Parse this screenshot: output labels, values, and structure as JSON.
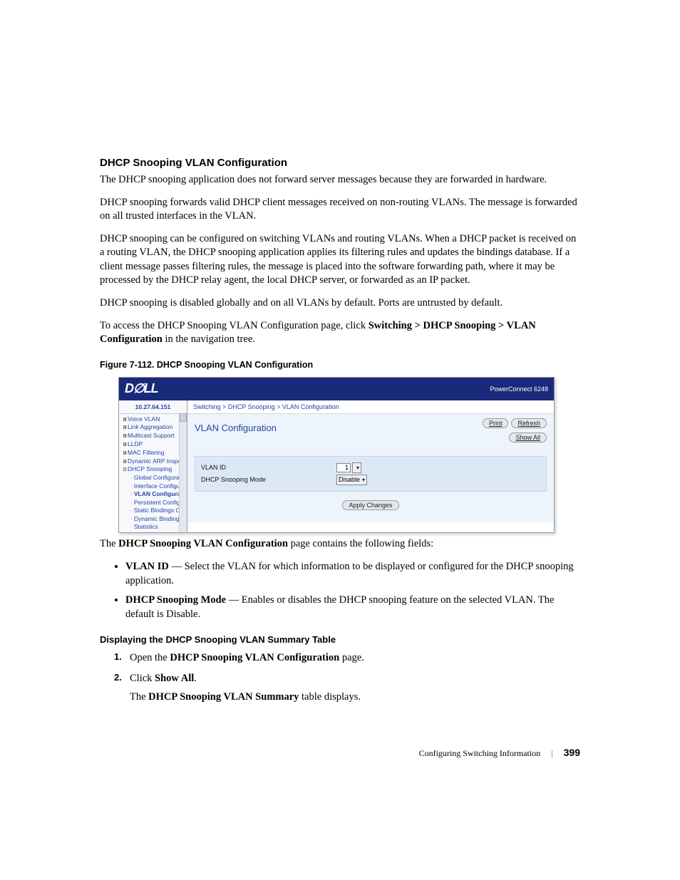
{
  "heading": "DHCP Snooping VLAN Configuration",
  "para1": "The DHCP snooping application does not forward server messages because they are forwarded in hardware.",
  "para2": "DHCP snooping forwards valid DHCP client messages received on non-routing VLANs. The message is forwarded on all trusted interfaces in the VLAN.",
  "para3": "DHCP snooping can be configured on switching VLANs and routing VLANs. When a DHCP packet is received on a routing VLAN, the DHCP snooping application applies its filtering rules and updates the bindings database. If a client message passes filtering rules, the message is placed into the software forwarding path, where it may be processed by the DHCP relay agent, the local DHCP server, or forwarded as an IP packet.",
  "para4": "DHCP snooping is disabled globally and on all VLANs by default. Ports are untrusted by default.",
  "para5_a": "To access the DHCP Snooping VLAN Configuration page, click ",
  "para5_b": "Switching > DHCP Snooping > VLAN Configuration",
  "para5_c": " in the navigation tree.",
  "figcap": "Figure 7-112.    DHCP Snooping VLAN Configuration",
  "shot": {
    "logo": "D∅LL",
    "product": "PowerConnect 6248",
    "ip": "10.27.64.151",
    "nav": {
      "items": [
        "Voice VLAN",
        "Link Aggregation",
        "Multicast Support",
        "LLDP",
        "MAC Filtering",
        "Dynamic ARP Inspe"
      ],
      "dhcp_label": "DHCP Snooping",
      "sub": [
        "Global Configurat",
        "Interface Configu",
        "VLAN Configurati",
        "Persistent Config",
        "Static Bindings C",
        "Dynamic Binding",
        "Statistics"
      ]
    },
    "breadcrumb": "Switching > DHCP Snooping > VLAN Configuration",
    "title": "VLAN Configuration",
    "buttons": {
      "print": "Print",
      "refresh": "Refresh",
      "showall": "Show All",
      "apply": "Apply Changes"
    },
    "fields": {
      "vlan_label": "VLAN ID",
      "vlan_value": "1",
      "mode_label": "DHCP Snooping Mode",
      "mode_value": "Disable"
    }
  },
  "after_a": "The ",
  "after_b": "DHCP Snooping VLAN Configuration",
  "after_c": " page contains the following fields:",
  "bullets": [
    {
      "term": "VLAN ID",
      "text": " — Select the VLAN for which information to be displayed or configured for the DHCP snooping application."
    },
    {
      "term": "DHCP Snooping Mode",
      "text": " — Enables or disables the DHCP snooping feature on the selected VLAN. The default is Disable."
    }
  ],
  "subheading": "Displaying the DHCP Snooping VLAN Summary Table",
  "steps": {
    "s1a": "Open the ",
    "s1b": "DHCP Snooping VLAN Configuration",
    "s1c": " page.",
    "s2a": "Click ",
    "s2b": "Show All",
    "s2c": ".",
    "s2_2a": "The ",
    "s2_2b": "DHCP Snooping VLAN Summary",
    "s2_2c": " table displays."
  },
  "footer": {
    "section": "Configuring Switching Information",
    "page": "399"
  }
}
